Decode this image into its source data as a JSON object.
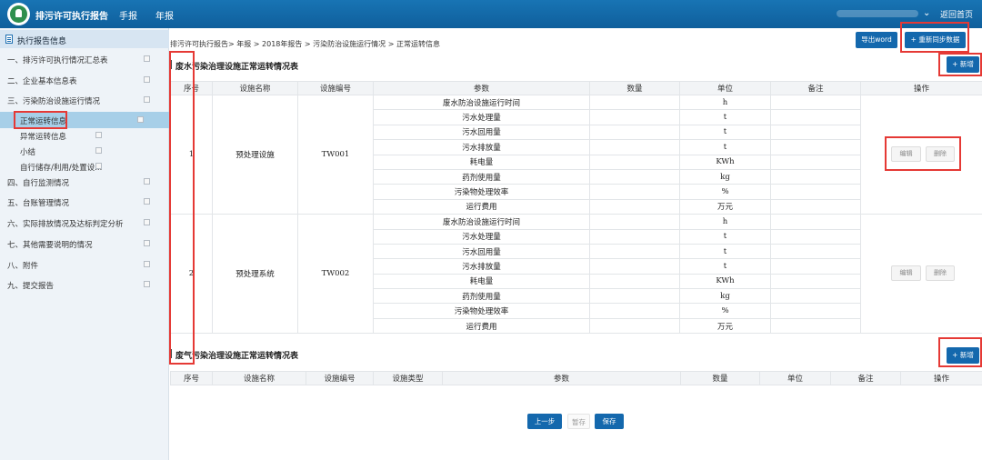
{
  "header": {
    "app_title": "排污许可执行报告",
    "nav": [
      "手报",
      "年报"
    ],
    "home_link": "返回首页"
  },
  "sidebar": {
    "title": "执行报告信息",
    "items": [
      {
        "label": "一、排污许可执行情况汇总表",
        "level": 0
      },
      {
        "label": "二、企业基本信息表",
        "level": 0
      },
      {
        "label": "三、污染防治设施运行情况",
        "level": 0
      },
      {
        "label": "正常运转信息",
        "level": 1,
        "active": true
      },
      {
        "label": "异常运转信息",
        "level": 1
      },
      {
        "label": "小结",
        "level": 1
      },
      {
        "label": "自行储存/利用/处置设...",
        "level": 1
      },
      {
        "label": "四、自行监测情况",
        "level": 0
      },
      {
        "label": "五、台账管理情况",
        "level": 0
      },
      {
        "label": "六、实际排放情况及达标判定分析",
        "level": 0
      },
      {
        "label": "七、其他需要说明的情况",
        "level": 0
      },
      {
        "label": "八、附件",
        "level": 0
      },
      {
        "label": "九、提交报告",
        "level": 0
      }
    ]
  },
  "breadcrumb": "排污许可执行报告> 年报 > 2018年报告 > 污染防治设施运行情况 > 正常运转信息",
  "toolbar": {
    "export_word": "导出word",
    "resync": "+ 重新同步数据"
  },
  "water_section": {
    "title": "废水污染治理设施正常运转情况表",
    "add_label": "+ 新增",
    "columns": [
      "序号",
      "设施名称",
      "设施编号",
      "参数",
      "数量",
      "单位",
      "备注",
      "操作"
    ],
    "rows": [
      {
        "no": "1",
        "name": "预处理设施",
        "code": "TW001",
        "params": [
          {
            "param": "废水防治设施运行时间",
            "qty": "",
            "unit": "h",
            "note": ""
          },
          {
            "param": "污水处理量",
            "qty": "",
            "unit": "t",
            "note": ""
          },
          {
            "param": "污水回用量",
            "qty": "",
            "unit": "t",
            "note": ""
          },
          {
            "param": "污水排放量",
            "qty": "",
            "unit": "t",
            "note": ""
          },
          {
            "param": "耗电量",
            "qty": "",
            "unit": "KWh",
            "note": ""
          },
          {
            "param": "药剂使用量",
            "qty": "",
            "unit": "kg",
            "note": ""
          },
          {
            "param": "污染物处理效率",
            "qty": "",
            "unit": "%",
            "note": ""
          },
          {
            "param": "运行费用",
            "qty": "",
            "unit": "万元",
            "note": ""
          }
        ],
        "edit": "编辑",
        "delete": "删除"
      },
      {
        "no": "2",
        "name": "预处理系统",
        "code": "TW002",
        "params": [
          {
            "param": "废水防治设施运行时间",
            "qty": "",
            "unit": "h",
            "note": ""
          },
          {
            "param": "污水处理量",
            "qty": "",
            "unit": "t",
            "note": ""
          },
          {
            "param": "污水回用量",
            "qty": "",
            "unit": "t",
            "note": ""
          },
          {
            "param": "污水排放量",
            "qty": "",
            "unit": "t",
            "note": ""
          },
          {
            "param": "耗电量",
            "qty": "",
            "unit": "KWh",
            "note": ""
          },
          {
            "param": "药剂使用量",
            "qty": "",
            "unit": "kg",
            "note": ""
          },
          {
            "param": "污染物处理效率",
            "qty": "",
            "unit": "%",
            "note": ""
          },
          {
            "param": "运行费用",
            "qty": "",
            "unit": "万元",
            "note": ""
          }
        ],
        "edit": "编辑",
        "delete": "删除"
      }
    ]
  },
  "gas_section": {
    "title": "废气污染治理设施正常运转情况表",
    "add_label": "+ 新增",
    "columns": [
      "序号",
      "设施名称",
      "设施编号",
      "设施类型",
      "参数",
      "数量",
      "单位",
      "备注",
      "操作"
    ]
  },
  "footer": {
    "prev": "上一步",
    "save_draft": "暂存",
    "save": "保存"
  },
  "colors": {
    "header_bg": "#1470b0",
    "primary_button": "#1468ad",
    "sidebar_active": "#a7cfe8",
    "highlight_box": "#e53935"
  }
}
